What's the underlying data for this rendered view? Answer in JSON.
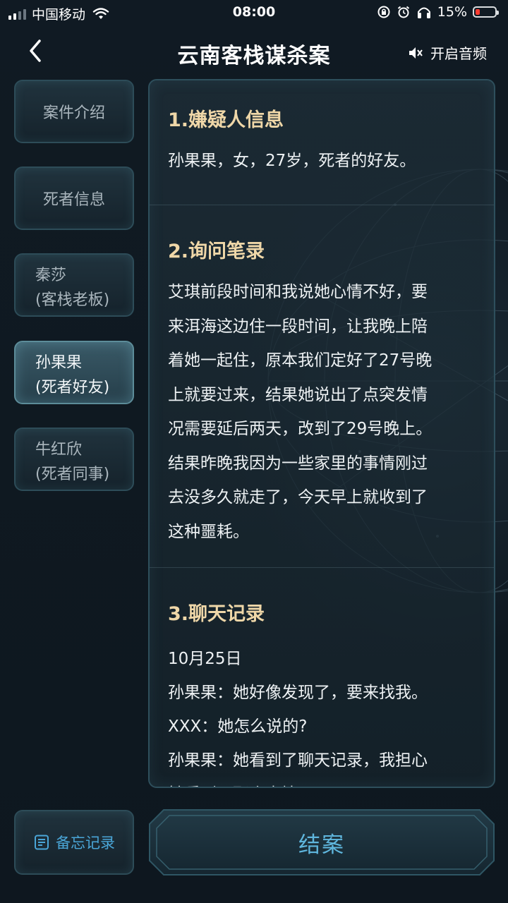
{
  "status_bar": {
    "carrier": "中国移动",
    "time": "08:00",
    "battery_percent": "15%"
  },
  "nav": {
    "title": "云南客栈谋杀案",
    "sound_label": "开启音频"
  },
  "sidebar": {
    "items": [
      {
        "line1": "案件介绍",
        "line2": ""
      },
      {
        "line1": "死者信息",
        "line2": ""
      },
      {
        "line1": "秦莎",
        "line2": "(客栈老板)"
      },
      {
        "line1": "孙果果",
        "line2": "(死者好友)"
      },
      {
        "line1": "牛红欣",
        "line2": "(死者同事)"
      }
    ],
    "active_index": 3
  },
  "content": {
    "section1": {
      "title": "1.嫌疑人信息",
      "text": "孙果果，女，27岁，死者的好友。"
    },
    "section2": {
      "title": "2.询问笔录",
      "lines": [
        "艾琪前段时间和我说她心情不好，要",
        "来洱海这边住一段时间，让我晚上陪",
        "着她一起住，原本我们定好了27号晚",
        "上就要过来，结果她说出了点突发情",
        "况需要延后两天，改到了29号晚上。",
        "结果昨晚我因为一些家里的事情刚过",
        "去没多久就走了，今天早上就收到了",
        "这种噩耗。"
      ]
    },
    "section3": {
      "title": "3.聊天记录",
      "lines": [
        "10月25日",
        "孙果果：她好像发现了，要来找我。",
        "XXX：她怎么说的?",
        "孙果果：她看到了聊天记录，我担心",
        "她看到了那个事情"
      ]
    }
  },
  "bottom": {
    "memo_label": "备忘记录",
    "close_case_label": "结案"
  },
  "colors": {
    "accent_blue": "#4aa6d8",
    "section_title": "#efd7a8",
    "battery_low": "#ff3b30"
  }
}
